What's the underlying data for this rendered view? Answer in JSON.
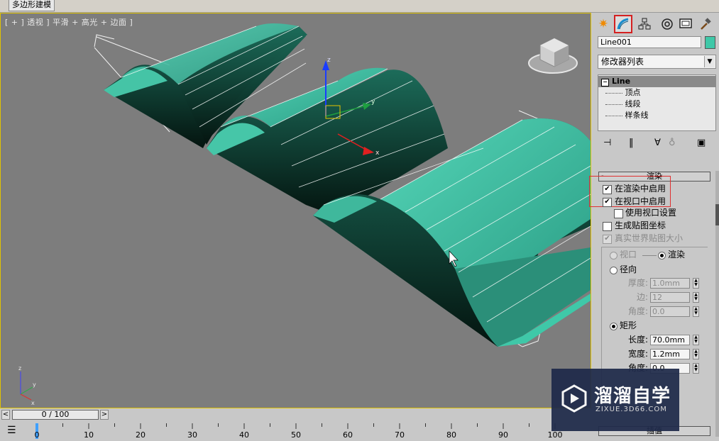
{
  "window": {
    "ribbon_tab": "多边形建模"
  },
  "viewport": {
    "label": "[ + ] 透视 ] 平滑 + 高光 + 边面 ]",
    "gizmo_x": "x",
    "gizmo_y": "y",
    "gizmo_z": "z",
    "axis_x": "x",
    "axis_y": "y",
    "axis_z": "z"
  },
  "command_panel": {
    "tabs": [
      {
        "icon": "create-sun-icon"
      },
      {
        "icon": "modify-icon",
        "active": true
      },
      {
        "icon": "hierarchy-icon"
      },
      {
        "icon": "motion-icon"
      },
      {
        "icon": "display-icon"
      },
      {
        "icon": "utilities-hammer-icon"
      }
    ],
    "object_name": "Line001",
    "object_color": "#3fc8a8",
    "modifier_list": "修改器列表",
    "stack": {
      "root": "Line",
      "subitems": [
        "顶点",
        "线段",
        "样条线"
      ]
    }
  },
  "rendering": {
    "header": "渲染",
    "collapse": "-",
    "enable_in_renderer": {
      "label": "在渲染中启用",
      "checked": true
    },
    "enable_in_viewport": {
      "label": "在视口中启用",
      "checked": true
    },
    "use_viewport_settings": {
      "label": "使用视口设置",
      "checked": false
    },
    "gen_mapping_coords": {
      "label": "生成贴图坐标",
      "checked": false
    },
    "real_world_map_size": {
      "label": "真实世界贴图大小",
      "checked": true,
      "disabled": true
    },
    "mode_viewport": "视口",
    "mode_render": "渲染",
    "radial": {
      "label": "径向",
      "thickness_label": "厚度:",
      "thickness": "1.0mm",
      "sides_label": "边:",
      "sides": "12",
      "angle_label": "角度:",
      "angle": "0.0"
    },
    "rectangular": {
      "label": "矩形",
      "length_label": "长度:",
      "length": "70.0mm",
      "width_label": "宽度:",
      "width": "1.2mm",
      "angle_label": "角度:",
      "angle": "0.0"
    },
    "next_rollout": "插值"
  },
  "timeline": {
    "frame": "0 / 100",
    "prev": "<",
    "next": ">",
    "ticks": [
      "0",
      "10",
      "20",
      "30",
      "40",
      "50",
      "60",
      "70",
      "80",
      "90",
      "100"
    ]
  },
  "watermark": {
    "title": "溜溜自学",
    "subtitle": "ZIXUE.3D66.COM"
  },
  "colors": {
    "viewport_bg": "#7d7d7d",
    "mesh_light": "#3fc8a8",
    "mesh_dark": "#0a2a22",
    "active_border": "#e1c300",
    "highlight_red": "#e03030"
  }
}
